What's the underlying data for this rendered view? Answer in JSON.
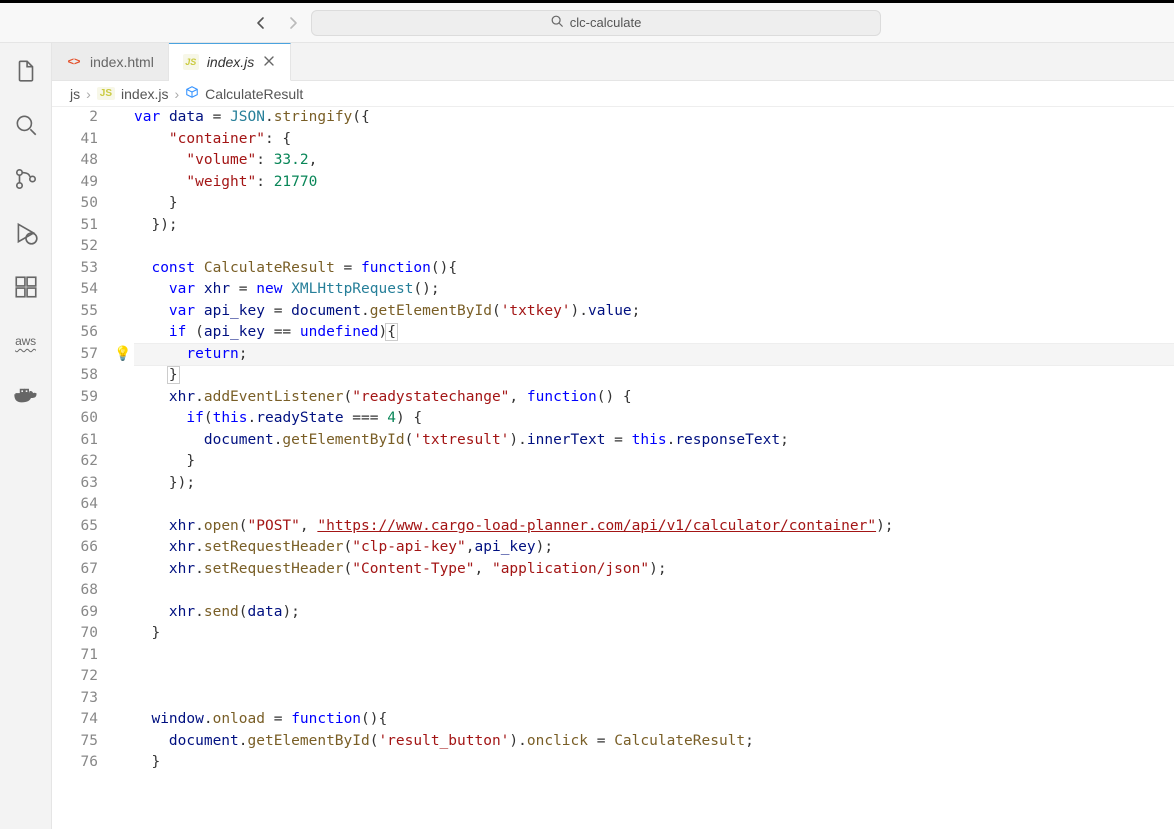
{
  "search": {
    "text": "clc-calculate"
  },
  "tabs": [
    {
      "icon": "html",
      "label": "index.html",
      "active": false,
      "closeable": false
    },
    {
      "icon": "js",
      "label": "index.js",
      "active": true,
      "closeable": true
    }
  ],
  "breadcrumbs": {
    "folder": "js",
    "file": "index.js",
    "symbol": "CalculateResult"
  },
  "lightbulb_line": 57,
  "code": {
    "lines": [
      {
        "n": 2,
        "indent": 0,
        "tokens": [
          [
            "kw",
            "var"
          ],
          [
            "",
            " "
          ],
          [
            "var",
            "data"
          ],
          [
            "",
            " = "
          ],
          [
            "glb",
            "JSON"
          ],
          [
            "",
            ". "
          ],
          [
            "fn",
            "stringify"
          ],
          [
            "",
            "({"
          ]
        ],
        "rawsuffix": ""
      },
      {
        "n": 41,
        "indent": 2,
        "tokens": [
          [
            "str",
            "\"container\""
          ],
          [
            "",
            ": {"
          ]
        ]
      },
      {
        "n": 48,
        "indent": 3,
        "tokens": [
          [
            "str",
            "\"volume\""
          ],
          [
            "",
            ": "
          ],
          [
            "num",
            "33.2"
          ],
          [
            "",
            ","
          ]
        ]
      },
      {
        "n": 49,
        "indent": 3,
        "tokens": [
          [
            "str",
            "\"weight\""
          ],
          [
            "",
            ": "
          ],
          [
            "num",
            "21770"
          ]
        ]
      },
      {
        "n": 50,
        "indent": 2,
        "tokens": [
          [
            "",
            "}"
          ]
        ]
      },
      {
        "n": 51,
        "indent": 1,
        "tokens": [
          [
            "",
            "});"
          ]
        ]
      },
      {
        "n": 52,
        "indent": 0,
        "tokens": []
      },
      {
        "n": 53,
        "indent": 1,
        "tokens": [
          [
            "kw",
            "const"
          ],
          [
            "",
            " "
          ],
          [
            "fn",
            "CalculateResult"
          ],
          [
            "",
            " = "
          ],
          [
            "kw",
            "function"
          ],
          [
            "",
            "(){"
          ]
        ]
      },
      {
        "n": 54,
        "indent": 2,
        "tokens": [
          [
            "kw",
            "var"
          ],
          [
            "",
            " "
          ],
          [
            "var",
            "xhr"
          ],
          [
            "",
            " = "
          ],
          [
            "nw",
            "new"
          ],
          [
            "",
            " "
          ],
          [
            "glb",
            "XMLHttpRequest"
          ],
          [
            "",
            "();"
          ]
        ]
      },
      {
        "n": 55,
        "indent": 2,
        "tokens": [
          [
            "kw",
            "var"
          ],
          [
            "",
            " "
          ],
          [
            "var",
            "api_key"
          ],
          [
            "",
            " = "
          ],
          [
            "var",
            "document"
          ],
          [
            "",
            ". "
          ],
          [
            "fn",
            "getElementById"
          ],
          [
            "",
            "("
          ],
          [
            "str",
            "'txtkey'"
          ],
          [
            "",
            ")."
          ],
          [
            "var",
            "value"
          ],
          [
            "",
            ";"
          ]
        ]
      },
      {
        "n": 56,
        "indent": 2,
        "tokens": [
          [
            "kw",
            "if"
          ],
          [
            "",
            " ("
          ],
          [
            "var",
            "api_key"
          ],
          [
            "",
            " == "
          ],
          [
            "undef",
            "undefined"
          ],
          [
            "",
            ")"
          ],
          [
            "brk",
            "{"
          ]
        ]
      },
      {
        "n": 57,
        "indent": 3,
        "tokens": [
          [
            "kw",
            "return"
          ],
          [
            "",
            ";"
          ]
        ],
        "current": true
      },
      {
        "n": 58,
        "indent": 2,
        "tokens": [
          [
            "brk",
            "}"
          ]
        ]
      },
      {
        "n": 59,
        "indent": 2,
        "tokens": [
          [
            "var",
            "xhr"
          ],
          [
            "",
            ". "
          ],
          [
            "fn",
            "addEventListener"
          ],
          [
            "",
            "("
          ],
          [
            "str",
            "\"readystatechange\""
          ],
          [
            "",
            ", "
          ],
          [
            "kw",
            "function"
          ],
          [
            "",
            "() {"
          ]
        ]
      },
      {
        "n": 60,
        "indent": 3,
        "tokens": [
          [
            "kw",
            "if"
          ],
          [
            "",
            "("
          ],
          [
            "this",
            "this"
          ],
          [
            "",
            ". "
          ],
          [
            "var",
            "readyState"
          ],
          [
            "",
            " === "
          ],
          [
            "num",
            "4"
          ],
          [
            "",
            ") {"
          ]
        ]
      },
      {
        "n": 61,
        "indent": 4,
        "tokens": [
          [
            "var",
            "document"
          ],
          [
            "",
            ". "
          ],
          [
            "fn",
            "getElementById"
          ],
          [
            "",
            "("
          ],
          [
            "str",
            "'txtresult'"
          ],
          [
            "",
            ")."
          ],
          [
            "var",
            "innerText"
          ],
          [
            "",
            " = "
          ],
          [
            "this",
            "this"
          ],
          [
            "",
            ". "
          ],
          [
            "var",
            "responseText"
          ],
          [
            "",
            ";"
          ]
        ]
      },
      {
        "n": 62,
        "indent": 3,
        "tokens": [
          [
            "",
            "}"
          ]
        ]
      },
      {
        "n": 63,
        "indent": 2,
        "tokens": [
          [
            "",
            "});"
          ]
        ]
      },
      {
        "n": 64,
        "indent": 0,
        "tokens": []
      },
      {
        "n": 65,
        "indent": 2,
        "tokens": [
          [
            "var",
            "xhr"
          ],
          [
            "",
            ". "
          ],
          [
            "fn",
            "open"
          ],
          [
            "",
            "("
          ],
          [
            "str",
            "\"POST\""
          ],
          [
            "",
            ", "
          ],
          [
            "strurl",
            "\"https://www.cargo-load-planner.com/api/v1/calculator/container\""
          ],
          [
            "",
            ");"
          ]
        ]
      },
      {
        "n": 66,
        "indent": 2,
        "tokens": [
          [
            "var",
            "xhr"
          ],
          [
            "",
            ". "
          ],
          [
            "fn",
            "setRequestHeader"
          ],
          [
            "",
            "("
          ],
          [
            "str",
            "\"clp-api-key\""
          ],
          [
            "",
            ","
          ],
          [
            "var",
            "api_key"
          ],
          [
            "",
            ");"
          ]
        ]
      },
      {
        "n": 67,
        "indent": 2,
        "tokens": [
          [
            "var",
            "xhr"
          ],
          [
            "",
            ". "
          ],
          [
            "fn",
            "setRequestHeader"
          ],
          [
            "",
            "("
          ],
          [
            "str",
            "\"Content-Type\""
          ],
          [
            "",
            ", "
          ],
          [
            "str",
            "\"application/json\""
          ],
          [
            "",
            ");"
          ]
        ]
      },
      {
        "n": 68,
        "indent": 0,
        "tokens": []
      },
      {
        "n": 69,
        "indent": 2,
        "tokens": [
          [
            "var",
            "xhr"
          ],
          [
            "",
            ". "
          ],
          [
            "fn",
            "send"
          ],
          [
            "",
            "("
          ],
          [
            "var",
            "data"
          ],
          [
            "",
            ");"
          ]
        ]
      },
      {
        "n": 70,
        "indent": 1,
        "tokens": [
          [
            "",
            "}"
          ]
        ]
      },
      {
        "n": 71,
        "indent": 0,
        "tokens": []
      },
      {
        "n": 72,
        "indent": 0,
        "tokens": []
      },
      {
        "n": 73,
        "indent": 0,
        "tokens": []
      },
      {
        "n": 74,
        "indent": 1,
        "tokens": [
          [
            "var",
            "window"
          ],
          [
            "",
            ". "
          ],
          [
            "fn",
            "onload"
          ],
          [
            "",
            " = "
          ],
          [
            "kw",
            "function"
          ],
          [
            "",
            "(){"
          ]
        ]
      },
      {
        "n": 75,
        "indent": 2,
        "tokens": [
          [
            "var",
            "document"
          ],
          [
            "",
            ". "
          ],
          [
            "fn",
            "getElementById"
          ],
          [
            "",
            "("
          ],
          [
            "str",
            "'result_button'"
          ],
          [
            "",
            ")."
          ],
          [
            "fn",
            "onclick"
          ],
          [
            "",
            " = "
          ],
          [
            "fn",
            "CalculateResult"
          ],
          [
            "",
            ";"
          ]
        ]
      },
      {
        "n": 76,
        "indent": 1,
        "tokens": [
          [
            "",
            "}"
          ]
        ]
      }
    ]
  }
}
